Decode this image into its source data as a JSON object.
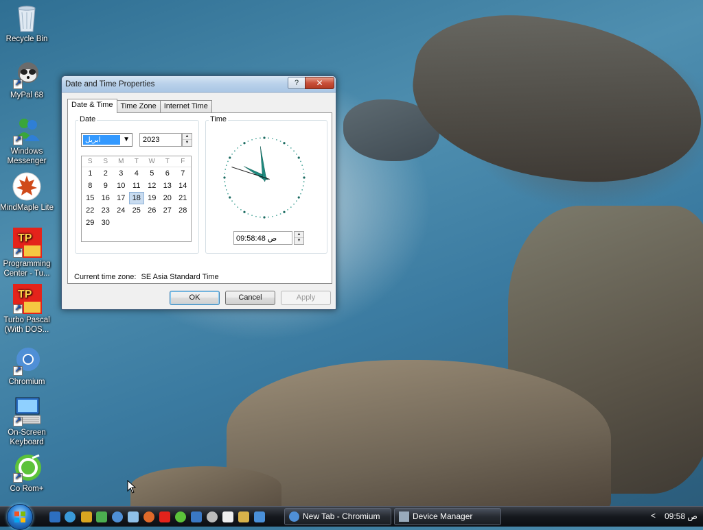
{
  "desktop": {
    "icons": [
      {
        "label": "Recycle Bin"
      },
      {
        "label": "MyPal 68"
      },
      {
        "label": "Windows Messenger"
      },
      {
        "label": "MindMaple Lite"
      },
      {
        "label": "Programming Center -  Tu..."
      },
      {
        "label": "Turbo Pascal (With DOS..."
      },
      {
        "label": "Chromium"
      },
      {
        "label": "On-Screen Keyboard"
      },
      {
        "label": "Co Rom+"
      }
    ]
  },
  "dialog": {
    "title": "Date and Time Properties",
    "help_label": "?",
    "close_label": "✕",
    "tabs": [
      {
        "label": "Date & Time",
        "active": true
      },
      {
        "label": "Time Zone",
        "active": false
      },
      {
        "label": "Internet Time",
        "active": false
      }
    ],
    "date_group_label": "Date",
    "month_value": "ابريل",
    "year_value": "2023",
    "weekday_headers": [
      "S",
      "S",
      "M",
      "T",
      "W",
      "T",
      "F"
    ],
    "days": [
      "1",
      "2",
      "3",
      "4",
      "5",
      "6",
      "7",
      "8",
      "9",
      "10",
      "11",
      "12",
      "13",
      "14",
      "15",
      "16",
      "17",
      "18",
      "19",
      "20",
      "21",
      "22",
      "23",
      "24",
      "25",
      "26",
      "27",
      "28",
      "29",
      "30"
    ],
    "selected_day": "18",
    "time_group_label": "Time",
    "clock": {
      "hour": 9,
      "minute": 58,
      "second": 48
    },
    "time_value": "09:58:48 ص",
    "timezone_label": "Current time zone:",
    "timezone_value": "SE Asia Standard Time",
    "ok_label": "OK",
    "cancel_label": "Cancel",
    "apply_label": "Apply"
  },
  "taskbar": {
    "tasks": [
      {
        "label": "New Tab - Chromium",
        "icon": "chromium-icon"
      },
      {
        "label": "Device Manager",
        "icon": "device-manager-icon"
      }
    ],
    "tray_arrow": "<",
    "clock": "ص 09:58"
  },
  "colors": {
    "selection": "#3399ff",
    "clock_hands": "#1f8a7f",
    "close_button": "#c9503a"
  }
}
